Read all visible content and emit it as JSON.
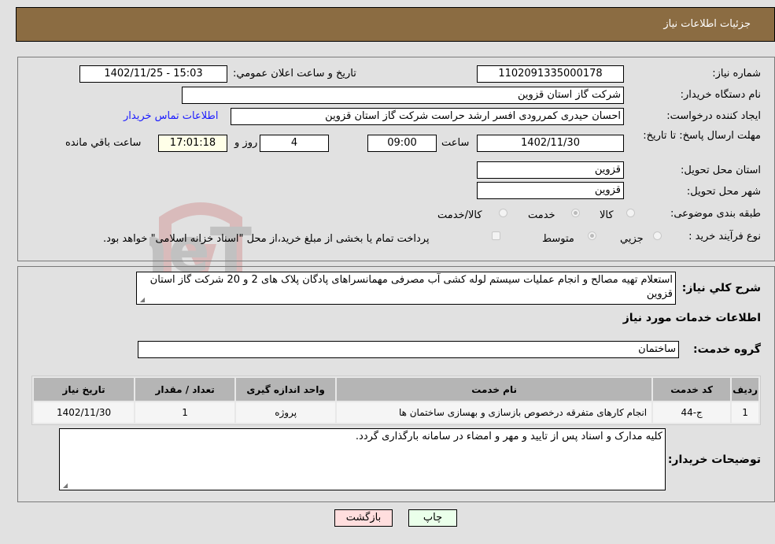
{
  "header": {
    "title": "جزئيات اطلاعات نياز"
  },
  "details": {
    "need_number_label": "شماره نياز:",
    "need_number": "1102091335000178",
    "announce_label": "تاريخ و ساعت اعلان عمومي:",
    "announce_value": "1402/11/25 - 15:03",
    "buyer_org_label": "نام دستگاه خريدار:",
    "buyer_org": "شرکت گاز استان قزوين",
    "creator_label": "ايجاد کننده درخواست:",
    "creator": "احسان حیدری کمررودی افسر ارشد حراست شرکت گاز استان قزوين",
    "contact_link": "اطلاعات تماس خريدار",
    "deadline_label": "مهلت ارسال پاسخ: تا تاريخ:",
    "deadline_date": "1402/11/30",
    "time_label": "ساعت",
    "deadline_time": "09:00",
    "days_remaining": "4",
    "days_label": "روز و",
    "time_remaining": "17:01:18",
    "remaining_label": "ساعت باقي مانده",
    "province_label": "استان محل تحويل:",
    "province": "قزوين",
    "city_label": "شهر محل تحويل:",
    "city": "قزوين",
    "category_label": "طبقه بندی موضوعی:",
    "category_options": [
      {
        "label": "کالا",
        "checked": false
      },
      {
        "label": "خدمت",
        "checked": true
      },
      {
        "label": "کالا/خدمت",
        "checked": false
      }
    ],
    "process_label": "نوع فرآيند خريد :",
    "process_options": [
      {
        "label": "جزيي",
        "checked": false
      },
      {
        "label": "متوسط",
        "checked": true
      }
    ],
    "treasury_note": "پرداخت تمام يا بخشی از مبلغ خريد،از محل \"اسناد خزانه اسلامی\" خواهد بود."
  },
  "description": {
    "label": "شرح كلي نياز:",
    "text": "استعلام تهیه مصالح و انجام عملیات سیستم لوله کشی آب مصرفی مهمانسراهای پادگان پلاک های 2 و 20 شرکت گاز استان قزوین"
  },
  "services": {
    "section_title": "اطلاعات خدمات مورد نياز",
    "group_label": "گروه خدمت:",
    "group_value": "ساختمان",
    "columns": [
      "رديف",
      "كد خدمت",
      "نام خدمت",
      "واحد اندازه گيری",
      "تعداد / مقدار",
      "تاريخ نياز"
    ],
    "rows": [
      [
        "1",
        "ج-44",
        "انجام کارهای متفرقه درخصوص بازسازی و بهسازی ساختمان ها",
        "پروژه",
        "1",
        "1402/11/30"
      ]
    ]
  },
  "buyer_notes": {
    "label": "توضيحات خريدار:",
    "text": "کلیه مدارک و اسناد پس از تایید و مهر و امضاء در سامانه بارگذاری گردد."
  },
  "buttons": {
    "print": "چاپ",
    "back": "بازگشت"
  },
  "watermark": {
    "text": "AriaTender.neT"
  },
  "colors": {
    "header_bg": "#8b6c42",
    "link": "#1a1aff",
    "back_bg": "#ffdede",
    "print_bg": "#eaffea"
  }
}
